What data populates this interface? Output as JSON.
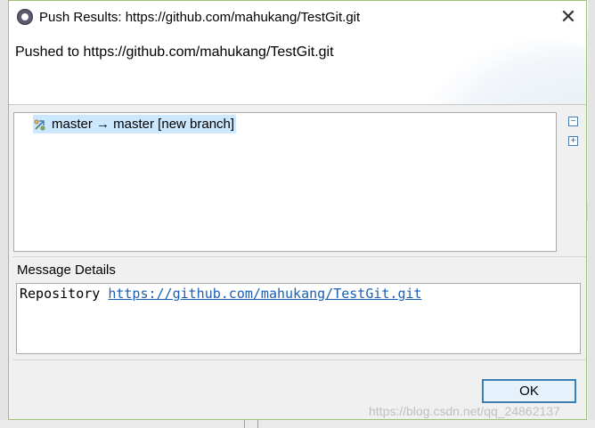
{
  "dialog": {
    "title": "Push Results: https://github.com/mahukang/TestGit.git",
    "close_icon": "close-icon",
    "header_message": "Pushed to https://github.com/mahukang/TestGit.git"
  },
  "results": {
    "rows": [
      {
        "icon": "push-branch-icon",
        "label": "master → master [new branch]"
      }
    ],
    "collapse_all_icon": "collapse-all-icon",
    "expand_all_icon": "expand-all-icon"
  },
  "message_details": {
    "label": "Message Details",
    "prefix": "Repository ",
    "link": "https://github.com/mahukang/TestGit.git"
  },
  "buttons": {
    "ok": "OK"
  },
  "watermark": "https://blog.csdn.net/qq_24862137",
  "colors": {
    "selection": "#cce8ff",
    "link": "#1a5fb4",
    "button_border": "#3c7fb1",
    "dialog_border": "#9ac27a"
  }
}
